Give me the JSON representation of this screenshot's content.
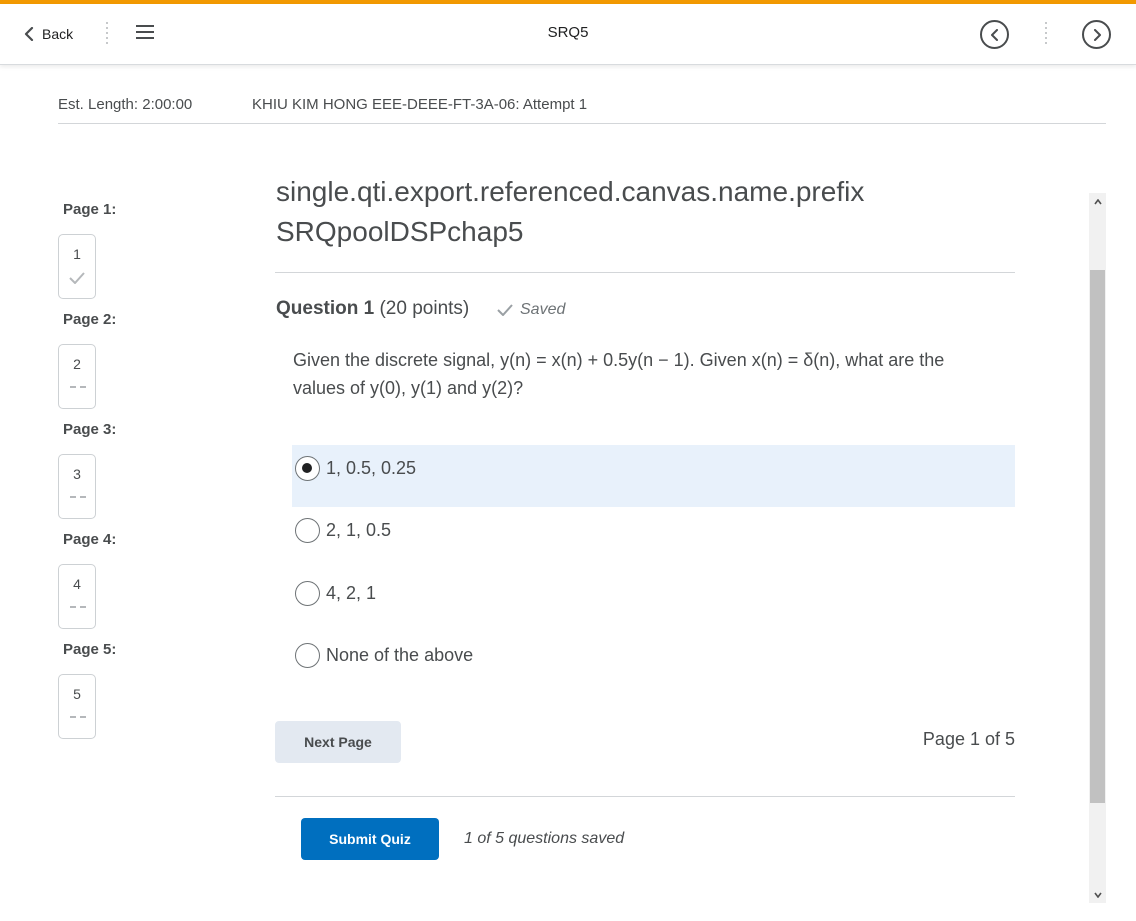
{
  "nav": {
    "back_label": "Back",
    "title": "SRQ5"
  },
  "info": {
    "est_length": "Est. Length: 2:00:00",
    "attempt": "KHIU KIM HONG EEE-DEEE-FT-3A-06: Attempt 1"
  },
  "pages": [
    {
      "label": "Page 1:",
      "num": "1",
      "status": "saved"
    },
    {
      "label": "Page 2:",
      "num": "2",
      "status": "unanswered"
    },
    {
      "label": "Page 3:",
      "num": "3",
      "status": "unanswered"
    },
    {
      "label": "Page 4:",
      "num": "4",
      "status": "unanswered"
    },
    {
      "label": "Page 5:",
      "num": "5",
      "status": "unanswered"
    }
  ],
  "content": {
    "title_line1": "single.qti.export.referenced.canvas.name.prefix",
    "title_line2": "SRQpoolDSPchap5",
    "question_label": "Question 1",
    "question_points": "(20 points)",
    "saved_label": "Saved",
    "question_text": "Given the discrete signal, y(n) = x(n) + 0.5y(n − 1). Given x(n) = δ(n), what are the values of y(0), y(1) and y(2)?",
    "options": [
      {
        "label": "1, 0.5, 0.25",
        "selected": true
      },
      {
        "label": "2, 1, 0.5",
        "selected": false
      },
      {
        "label": "4, 2, 1",
        "selected": false
      },
      {
        "label": "None of the above",
        "selected": false
      }
    ],
    "next_page_label": "Next Page",
    "page_of": "Page 1 of 5",
    "submit_label": "Submit Quiz",
    "saved_count": "1 of 5 questions saved"
  },
  "colors": {
    "accent": "#f29901",
    "primary_button": "#006fbf",
    "selected_option_bg": "#e8f1fb"
  }
}
